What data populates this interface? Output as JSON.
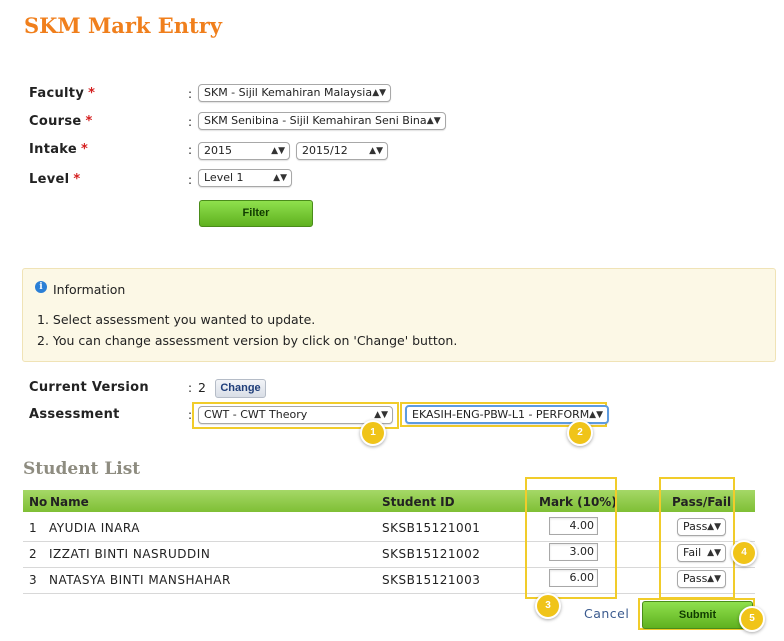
{
  "page": {
    "title": "SKM Mark Entry"
  },
  "filters": {
    "faculty": {
      "label": "Faculty",
      "value": "SKM - Sijil Kemahiran Malaysia"
    },
    "course": {
      "label": "Course",
      "value": "SKM Senibina - Sijil Kemahiran Seni Bina"
    },
    "intake": {
      "label": "Intake",
      "year": "2015",
      "session": "2015/12"
    },
    "level": {
      "label": "Level",
      "value": "Level 1"
    },
    "required_mark": "*",
    "colon": ":",
    "filter_button": "Filter"
  },
  "info": {
    "title": "Information",
    "icon": "info-icon",
    "items": [
      "1.  Select assessment you wanted to update.",
      "2.  You can change assessment version by click on 'Change' button."
    ]
  },
  "version": {
    "label": "Current Version",
    "value": "2",
    "change_button": "Change"
  },
  "assessment": {
    "label": "Assessment",
    "type_value": "CWT - CWT Theory",
    "code_value": "EKASIH-ENG-PBW-L1 - PERFORM"
  },
  "student_list": {
    "title": "Student List",
    "columns": {
      "no": "No",
      "name": "Name",
      "student_id": "Student ID",
      "mark": "Mark (10%)",
      "pass_fail": "Pass/Fail"
    },
    "rows": [
      {
        "no": "1",
        "name": "AYUDIA INARA",
        "student_id": "SKSB15121001",
        "mark": "4.00",
        "pass_fail": "Pass"
      },
      {
        "no": "2",
        "name": "IZZATI BINTI NASRUDDIN",
        "student_id": "SKSB15121002",
        "mark": "3.00",
        "pass_fail": "Fail"
      },
      {
        "no": "3",
        "name": "NATASYA BINTI MANSHAHAR",
        "student_id": "SKSB15121003",
        "mark": "6.00",
        "pass_fail": "Pass"
      }
    ]
  },
  "actions": {
    "cancel": "Cancel",
    "submit": "Submit"
  },
  "callouts": [
    "1",
    "2",
    "3",
    "4",
    "5"
  ],
  "colors": {
    "title": "#f07f1c",
    "button_green": "#6cc22a",
    "highlight": "#f1cc2a",
    "info_bg": "#fcf8e6"
  }
}
